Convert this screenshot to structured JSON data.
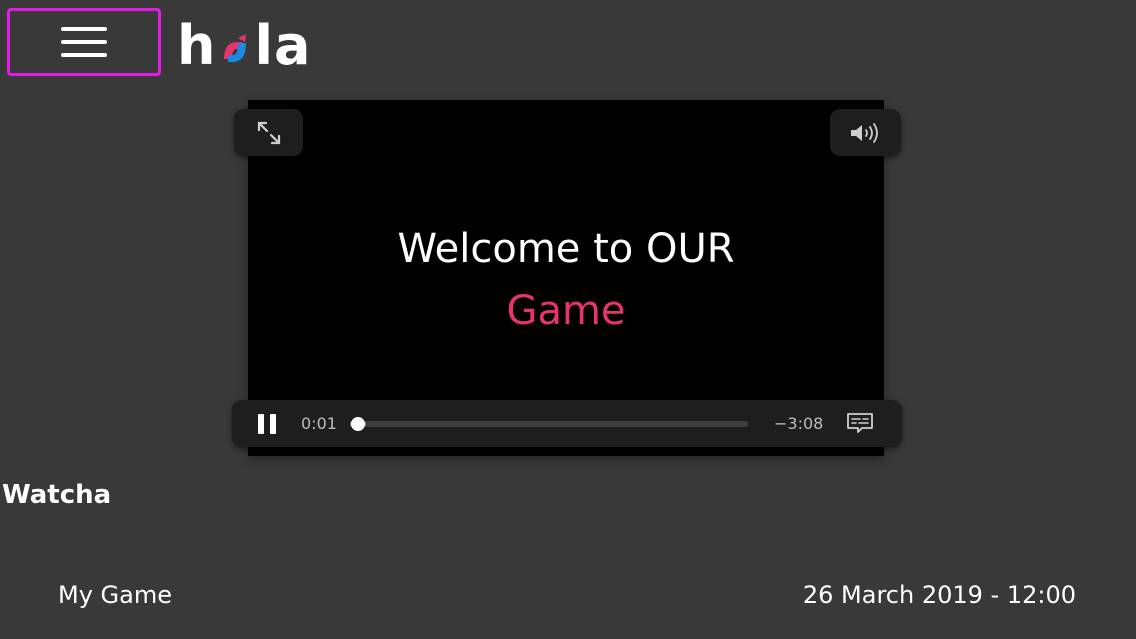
{
  "header": {
    "menu_label": "",
    "logo": {
      "text_before": "h",
      "text_after": "la",
      "accent_colors": [
        "#e8336c",
        "#1e88e5"
      ]
    }
  },
  "player": {
    "video_text_line1": "Welcome to OUR",
    "video_text_line2": "Game",
    "video_text_color_line2": "#e8336c",
    "current_time": "0:01",
    "remaining_time": "−3:08",
    "progress": 0.015,
    "icons": {
      "fullscreen": "expand-arrows-icon",
      "volume": "speaker-icon",
      "pause": "pause-icon",
      "captions": "captions-icon"
    }
  },
  "content": {
    "section_title": "Watcha",
    "game_name": "My Game",
    "game_date": "26 March 2019 - 12:00"
  },
  "colors": {
    "background": "#3a393a",
    "menu_outline": "#e31ae8"
  }
}
